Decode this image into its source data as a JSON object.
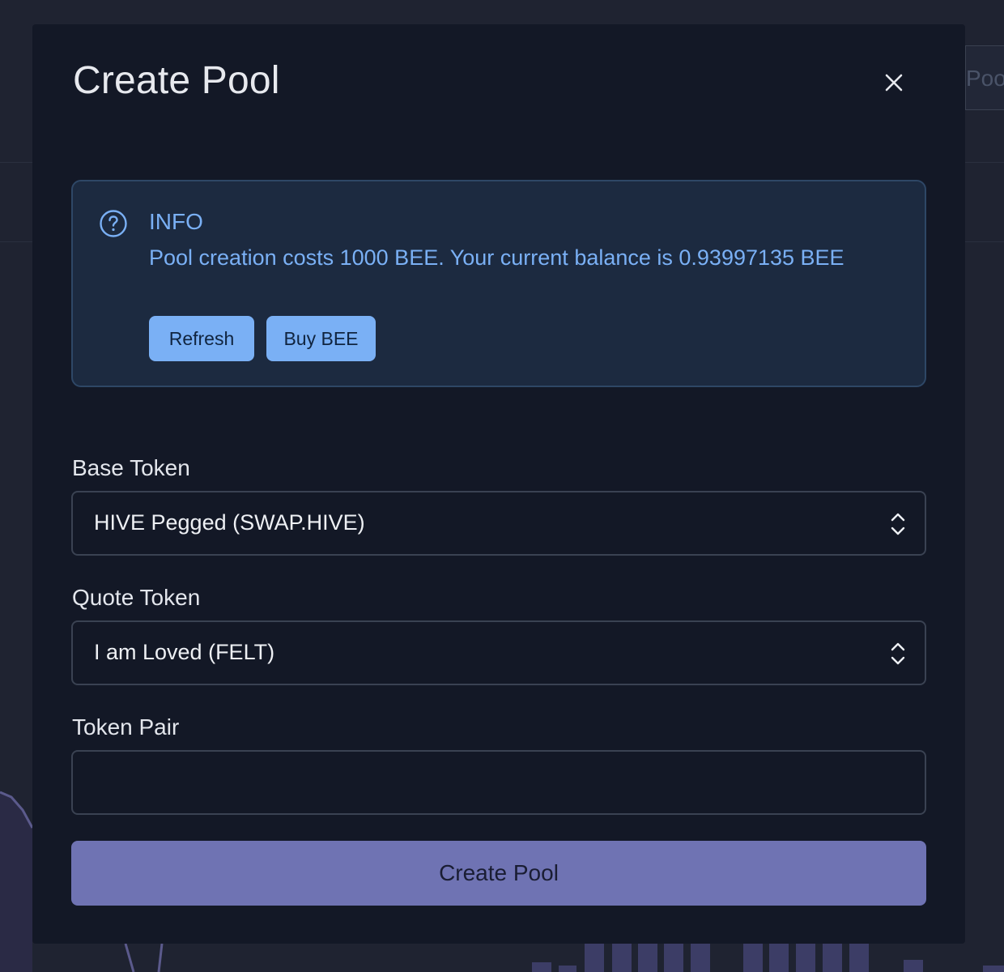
{
  "background": {
    "tab_label": "Poo"
  },
  "modal": {
    "title": "Create Pool",
    "close_label": "Close"
  },
  "info": {
    "title": "INFO",
    "message": "Pool creation costs 1000 BEE. Your current balance is 0.93997135 BEE",
    "refresh_label": "Refresh",
    "buy_label": "Buy BEE"
  },
  "form": {
    "base_token_label": "Base Token",
    "base_token_value": "HIVE Pegged (SWAP.HIVE)",
    "quote_token_label": "Quote Token",
    "quote_token_value": "I am Loved (FELT)",
    "token_pair_label": "Token Pair",
    "token_pair_value": "",
    "submit_label": "Create Pool"
  },
  "colors": {
    "accent": "#7ab0f5",
    "submit": "#6f73b3",
    "modal_bg": "#131826"
  }
}
